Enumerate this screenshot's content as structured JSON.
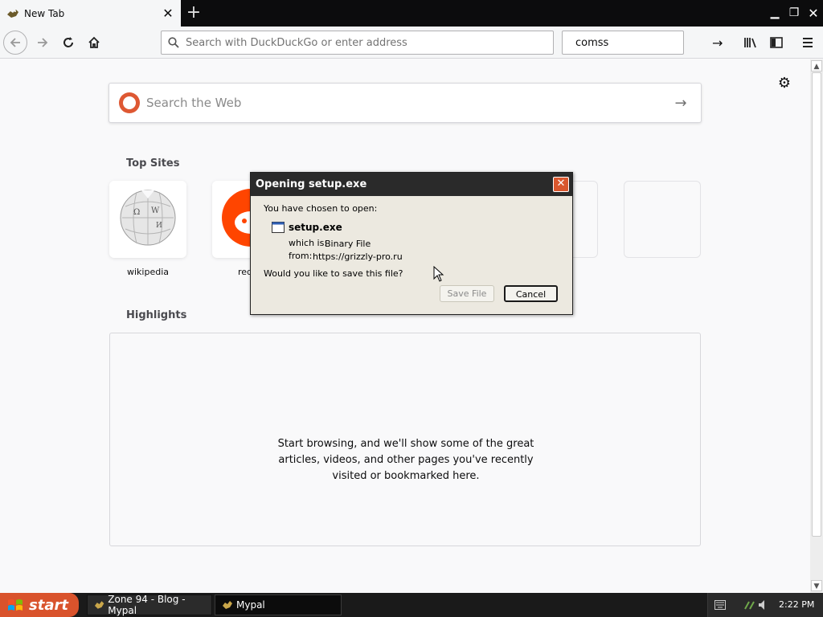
{
  "browser": {
    "tab": {
      "title": "New Tab"
    },
    "urlbar": {
      "placeholder": "Search with DuckDuckGo or enter address"
    },
    "searchbar": {
      "value": "comss"
    }
  },
  "newtab": {
    "websearch": {
      "placeholder": "Search the Web"
    },
    "top_sites_title": "Top Sites",
    "top_sites": [
      {
        "label": "wikipedia"
      },
      {
        "label": "red"
      }
    ],
    "highlights_title": "Highlights",
    "highlights_empty": "Start browsing, and we'll show some of the great articles, videos, and other pages you've recently visited or bookmarked here."
  },
  "dialog": {
    "title": "Opening setup.exe",
    "intro": "You have chosen to open:",
    "filename": "setup.exe",
    "which_is_label": "which is:",
    "which_is_value": "Binary File",
    "from_label": "from:",
    "from_value": "https://grizzly-pro.ru",
    "question": "Would you like to save this file?",
    "save_label": "Save File",
    "cancel_label": "Cancel"
  },
  "taskbar": {
    "start_label": "start",
    "tasks": [
      {
        "label": "Zone 94 - Blog - Mypal"
      },
      {
        "label": "Mypal"
      }
    ],
    "clock": "2:22 PM"
  },
  "colors": {
    "accent_orange": "#d9532c",
    "ddg_orange": "#de5833",
    "reddit_orange": "#ff4500",
    "dialog_bg": "#ece9e0"
  }
}
